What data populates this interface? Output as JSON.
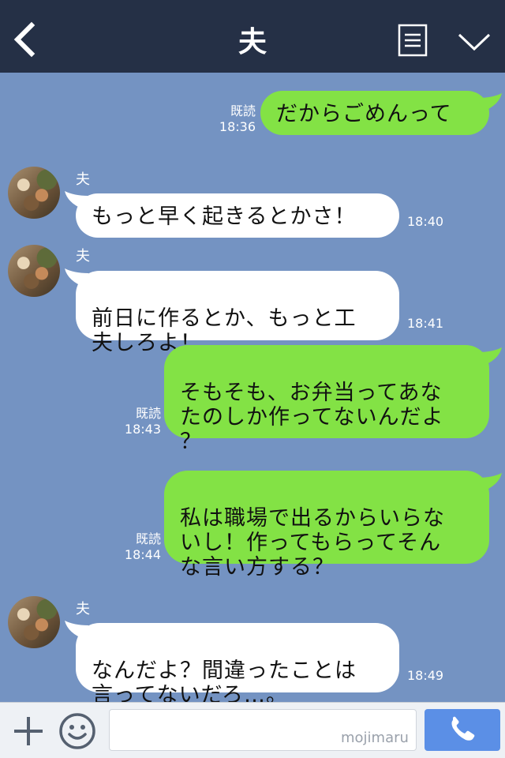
{
  "header": {
    "title": "夫",
    "back_icon": "chevron-left-icon",
    "menu_icon": "list-menu-icon",
    "dropdown_icon": "chevron-down-icon",
    "background": "#253046"
  },
  "chat": {
    "background": "#7493c2",
    "outgoing_color": "#83e245",
    "incoming_color": "#ffffff",
    "messages": [
      {
        "side": "right",
        "text": "だからごめんって",
        "read_label": "既読",
        "time": "18:36"
      },
      {
        "side": "left",
        "sender": "夫",
        "text": "もっと早く起きるとかさ！",
        "time": "18:40"
      },
      {
        "side": "left",
        "sender": "夫",
        "text": "前日に作るとか、もっと工\n夫しろよ！",
        "time": "18:41"
      },
      {
        "side": "right",
        "text": "そもそも、お弁当ってあな\nたのしか作ってないんだよ\n？",
        "read_label": "既読",
        "time": "18:43"
      },
      {
        "side": "right",
        "text": "私は職場で出るからいらな\nいし！作ってもらってそん\nな言い方する？",
        "read_label": "既読",
        "time": "18:44"
      },
      {
        "side": "left",
        "sender": "夫",
        "text": "なんだよ？間違ったことは\n言ってないだろ…。",
        "time": "18:49"
      }
    ]
  },
  "input_bar": {
    "plus_icon": "plus-icon",
    "emoji_icon": "smiley-icon",
    "input_value": "",
    "watermark": "mojimaru",
    "call_icon": "phone-icon",
    "call_color": "#5b8fe6"
  }
}
